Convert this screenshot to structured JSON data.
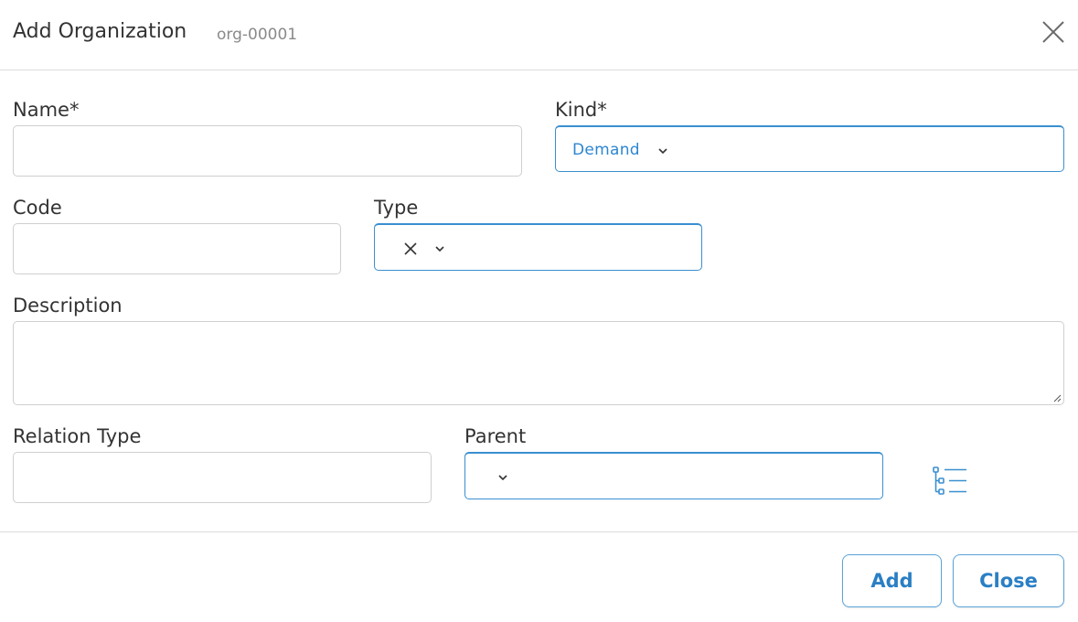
{
  "header": {
    "title": "Add Organization",
    "subtitle": "org-00001"
  },
  "form": {
    "name": {
      "label": "Name*",
      "value": ""
    },
    "kind": {
      "label": "Kind*",
      "value": "Demand"
    },
    "code": {
      "label": "Code",
      "value": ""
    },
    "type": {
      "label": "Type",
      "value": ""
    },
    "description": {
      "label": "Description",
      "value": ""
    },
    "relation_type": {
      "label": "Relation Type",
      "value": ""
    },
    "parent": {
      "label": "Parent",
      "value": ""
    }
  },
  "footer": {
    "add_label": "Add",
    "close_label": "Close"
  },
  "colors": {
    "accent": "#2d86d1",
    "border": "#cfcfcf",
    "select_border": "#3a8fd0"
  },
  "icons": [
    "close-icon",
    "chevron-down-icon",
    "clear-icon",
    "tree-view-icon",
    "resize-grip-icon"
  ]
}
